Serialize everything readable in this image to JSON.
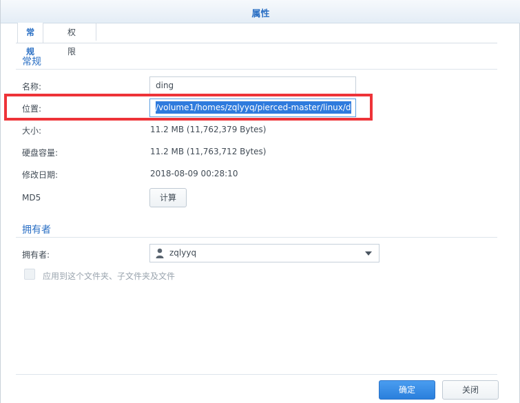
{
  "window": {
    "title": "属性"
  },
  "tabs": [
    {
      "label": "常规",
      "active": true
    },
    {
      "label": "权限",
      "active": false
    }
  ],
  "general": {
    "section_title": "常规",
    "name_label": "名称:",
    "name_value": "ding",
    "location_label": "位置:",
    "location_value": "/volume1/homes/zqlyyq/pierced-master/linux/d",
    "size_label": "大小:",
    "size_value": "11.2 MB (11,762,379 Bytes)",
    "disk_label": "硬盘容量:",
    "disk_value": "11.2 MB (11,763,712 Bytes)",
    "modified_label": "修改日期:",
    "modified_value": "2018-08-09 00:28:10",
    "md5_label": "MD5",
    "md5_button": "计算"
  },
  "owner": {
    "section_title": "拥有者",
    "owner_label": "拥有者:",
    "owner_value": "zqlyyq",
    "apply_label": "应用到这个文件夹、子文件夹及文件",
    "apply_checked": false
  },
  "footer": {
    "ok_label": "确定",
    "close_label": "关闭"
  },
  "colors": {
    "accent": "#2a6fc4",
    "highlight": "#ee3338",
    "primary_button": "#2f86e4"
  }
}
